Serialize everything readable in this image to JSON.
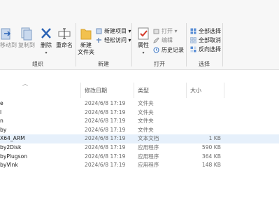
{
  "ribbon": {
    "organize": {
      "label": "组织",
      "move_to": "移动到",
      "copy_to": "复制到",
      "delete": "删除",
      "rename": "重命名"
    },
    "new": {
      "label": "新建",
      "new_folder": "新建\n文件夹",
      "new_item": "新建项目 ▾",
      "easy_access": "轻松访问 ▾"
    },
    "open": {
      "label": "打开",
      "properties": "属性",
      "open": "打开 ▾",
      "edit": "编辑",
      "history": "历史记录"
    },
    "select": {
      "label": "选择",
      "select_all": "全部选择",
      "select_none": "全部取消",
      "invert": "反向选择"
    }
  },
  "columns": {
    "date": "修改日期",
    "type": "类型",
    "size": "大小"
  },
  "files": [
    {
      "name": "e",
      "date": "2024/6/8 17:19",
      "type": "文件夹",
      "size": ""
    },
    {
      "name": "l",
      "date": "2024/6/8 17:19",
      "type": "文件夹",
      "size": ""
    },
    {
      "name": "n",
      "date": "2024/6/8 17:19",
      "type": "文件夹",
      "size": ""
    },
    {
      "name": "by",
      "date": "2024/6/8 17:19",
      "type": "文件夹",
      "size": ""
    },
    {
      "name": "X64_ARM",
      "date": "2024/6/8 17:19",
      "type": "文本文档",
      "size": "1 KB",
      "selected": true
    },
    {
      "name": "by2Disk",
      "date": "2024/6/8 17:19",
      "type": "应用程序",
      "size": "590 KB"
    },
    {
      "name": "byPlugson",
      "date": "2024/6/8 17:19",
      "type": "应用程序",
      "size": "364 KB"
    },
    {
      "name": "byVlnk",
      "date": "2024/6/8 17:19",
      "type": "应用程序",
      "size": "148 KB"
    }
  ],
  "colors": {
    "accent": "#0a64c8",
    "selected_row": "#e6f0fb",
    "delete_x": "#2b63b5",
    "properties_check": "#d43a2a"
  }
}
